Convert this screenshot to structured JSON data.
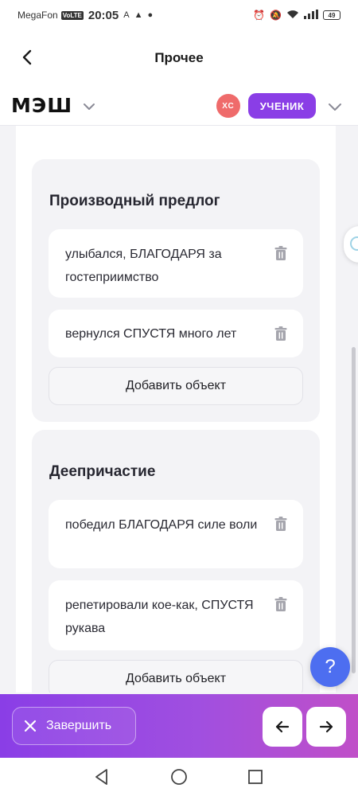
{
  "status_bar": {
    "carrier": "MegaFon",
    "volte": "VoLTE",
    "time": "20:05",
    "battery": "49"
  },
  "nav": {
    "title": "Прочее"
  },
  "brand": {
    "logo": "МЭШ",
    "avatar_initials": "ХС",
    "role": "УЧЕНИК"
  },
  "groups": [
    {
      "title": "Производный предлог",
      "items": [
        "улыбался, БЛАГОДАРЯ за гостеприимство",
        "вернулся СПУСТЯ много лет"
      ],
      "add_label": "Добавить объект"
    },
    {
      "title": "Деепричастие",
      "items": [
        "победил БЛАГОДАРЯ силе воли",
        "репетировали кое-как, СПУСТЯ рукава"
      ],
      "add_label": "Добавить объект"
    }
  ],
  "help": {
    "label": "?"
  },
  "action_bar": {
    "finish_label": "Завершить"
  },
  "colors": {
    "accent": "#8a3ee6",
    "avatar": "#ef6b6b",
    "help": "#4d6ef0"
  }
}
